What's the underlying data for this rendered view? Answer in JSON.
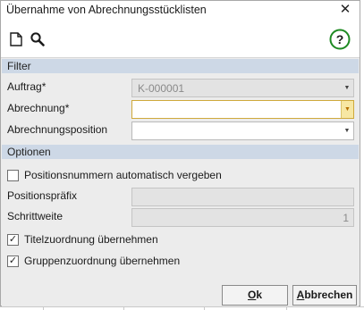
{
  "window": {
    "title": "Übernahme von Abrechnungsstücklisten",
    "close_glyph": "✕"
  },
  "toolbar": {
    "icons": [
      "new-document-icon",
      "search-icon",
      "help-icon"
    ],
    "help_glyph": "?"
  },
  "sections": {
    "filter": "Filter",
    "options": "Optionen"
  },
  "fields": {
    "auftrag": {
      "label": "Auftrag*",
      "value": "K-000001",
      "enabled": false
    },
    "abrechnung": {
      "label": "Abrechnung*",
      "value": "",
      "enabled": true
    },
    "abrechnungsposition": {
      "label": "Abrechnungsposition",
      "value": "",
      "enabled": true
    },
    "positionspraefix": {
      "label": "Positionspräfix",
      "value": "",
      "enabled": false
    },
    "schrittweite": {
      "label": "Schrittweite",
      "value": "1",
      "enabled": false
    }
  },
  "checkboxes": {
    "positionsnummern": {
      "label": "Positionsnummern automatisch vergeben",
      "checked": false
    },
    "titelzuordnung": {
      "label": "Titelzuordnung übernehmen",
      "checked": true
    },
    "gruppenzuordnung": {
      "label": "Gruppenzuordnung übernehmen",
      "checked": true
    }
  },
  "buttons": {
    "ok": "Ok",
    "cancel": "Abbrechen"
  },
  "glyphs": {
    "dropdown_arrow": "▼",
    "check": "✓"
  },
  "colors": {
    "section_header": "#cdd8e6",
    "help_green": "#1e8a22",
    "required_dropdown": "#f7e7a3"
  }
}
